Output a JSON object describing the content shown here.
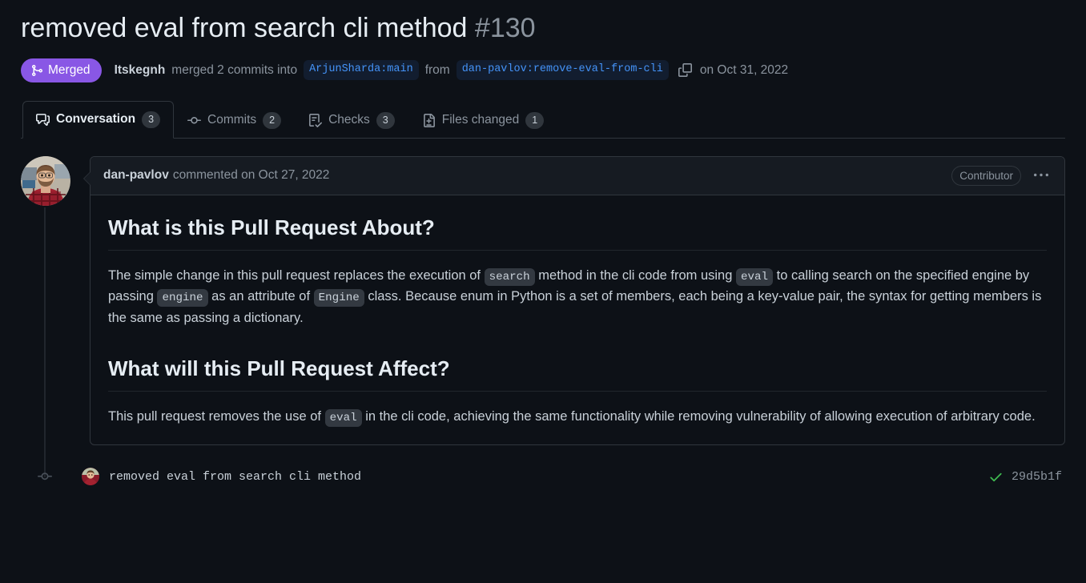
{
  "header": {
    "title": "removed eval from search cli method",
    "number": "#130",
    "state": {
      "label": "Merged",
      "icon": "git-merge-icon",
      "color": "#8957e5"
    },
    "merged_by": "Itskegnh",
    "merged_text": "merged 2 commits into",
    "base_branch": "ArjunSharda:main",
    "from_text": "from",
    "head_branch": "dan-pavlov:remove-eval-from-cli",
    "copy_icon": "copy-icon",
    "merged_date": "on Oct 31, 2022"
  },
  "tabs": [
    {
      "label": "Conversation",
      "count": "3",
      "icon": "comment-discussion-icon",
      "active": true
    },
    {
      "label": "Commits",
      "count": "2",
      "icon": "git-commit-icon",
      "active": false
    },
    {
      "label": "Checks",
      "count": "3",
      "icon": "checklist-icon",
      "active": false
    },
    {
      "label": "Files changed",
      "count": "1",
      "icon": "file-diff-icon",
      "active": false
    }
  ],
  "comment": {
    "author": "dan-pavlov",
    "action": "commented on Oct 27, 2022",
    "role_badge": "Contributor",
    "kebab": "•••",
    "sections": [
      {
        "heading": "What is this Pull Request About?",
        "paragraph": [
          {
            "t": "text",
            "v": "The simple change in this pull request replaces the execution of "
          },
          {
            "t": "code",
            "v": "search"
          },
          {
            "t": "text",
            "v": " method in the cli code from using "
          },
          {
            "t": "code",
            "v": "eval"
          },
          {
            "t": "text",
            "v": " to calling search on the specified engine by passing "
          },
          {
            "t": "code",
            "v": "engine"
          },
          {
            "t": "text",
            "v": " as an attribute of "
          },
          {
            "t": "code",
            "v": "Engine"
          },
          {
            "t": "text",
            "v": " class. Because enum in Python is a set of members, each being a key-value pair, the syntax for getting members is the same as passing a dictionary."
          }
        ]
      },
      {
        "heading": "What will this Pull Request Affect?",
        "paragraph": [
          {
            "t": "text",
            "v": "This pull request removes the use of "
          },
          {
            "t": "code",
            "v": "eval"
          },
          {
            "t": "text",
            "v": " in the cli code, achieving the same functionality while removing vulnerability of allowing execution of arbitrary code."
          }
        ]
      }
    ]
  },
  "commit_event": {
    "message": "removed eval from search cli method",
    "sha": "29d5b1f",
    "status_icon": "check-icon",
    "status_color": "#3fb950"
  }
}
